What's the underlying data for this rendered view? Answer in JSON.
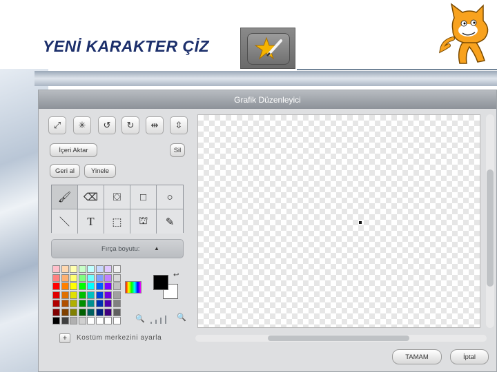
{
  "slide": {
    "title": "YENİ KARAKTER ÇİZ"
  },
  "editor": {
    "title": "Grafik Düzenleyici",
    "toolbar_icons": [
      "grow-icon",
      "shrink-icon",
      "rotate-left-icon",
      "rotate-right-icon",
      "flip-horizontal-icon",
      "flip-vertical-icon"
    ],
    "import_label": "İçeri Aktar",
    "delete_label": "Sil",
    "undo_label": "Geri al",
    "redo_label": "Yinele",
    "tools": [
      "paintbrush",
      "eraser",
      "fill-bucket",
      "rectangle",
      "ellipse",
      "line",
      "text",
      "select",
      "stamp",
      "eyedropper"
    ],
    "brush_size_label": "Fırça boyutu:",
    "foreground_color": "#000000",
    "background_color": "#ffffff",
    "palette": [
      [
        "#ffc0cb",
        "#ffd8b0",
        "#ffffb0",
        "#c8ffc8",
        "#c0ffff",
        "#c8d8ff",
        "#e0c8ff",
        "#f0f0f0"
      ],
      [
        "#ff8080",
        "#ffb070",
        "#ffff70",
        "#80ff80",
        "#70ffff",
        "#80a0ff",
        "#c080ff",
        "#d8d8d8"
      ],
      [
        "#ff0000",
        "#ff8000",
        "#ffff00",
        "#00ff00",
        "#00ffff",
        "#0060ff",
        "#8000ff",
        "#c0c0c0"
      ],
      [
        "#e00000",
        "#e07000",
        "#e0e000",
        "#00c000",
        "#00c0c0",
        "#0040e0",
        "#7000e0",
        "#a0a0a0"
      ],
      [
        "#b00000",
        "#b05000",
        "#b0b000",
        "#009000",
        "#009090",
        "#0030b0",
        "#5000b0",
        "#808080"
      ],
      [
        "#800000",
        "#804000",
        "#808000",
        "#006000",
        "#006060",
        "#002080",
        "#400080",
        "#606060"
      ],
      [
        "#000000",
        "#404040",
        "#b0b0b0",
        "#d0d0d0",
        "#ffffff",
        "#ffffff",
        "#ffffff",
        "#ffffff"
      ]
    ],
    "set_center_label": "Kostüm merkezini ayarla",
    "ok_label": "TAMAM",
    "cancel_label": "İptal"
  }
}
